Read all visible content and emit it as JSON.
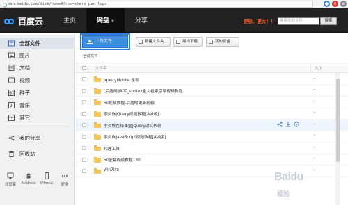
{
  "browser": {
    "url": "pan.baidu.com/disk/home#from=share_pan_logo"
  },
  "topnav": {
    "logo_text": "百度云",
    "items": [
      {
        "label": "主页"
      },
      {
        "label": "网盘"
      },
      {
        "label": "分享"
      }
    ],
    "promo_text": "更快、更大！！",
    "search_placeholder": "搜索你的文件",
    "search_button": "搜索"
  },
  "sidebar": {
    "items": [
      {
        "label": "全部文件",
        "icon": "all-files-icon"
      },
      {
        "label": "图片",
        "icon": "image-icon"
      },
      {
        "label": "文档",
        "icon": "document-icon"
      },
      {
        "label": "视频",
        "icon": "video-icon"
      },
      {
        "label": "种子",
        "icon": "torrent-icon"
      },
      {
        "label": "音乐",
        "icon": "music-icon"
      },
      {
        "label": "其它",
        "icon": "other-icon"
      },
      {
        "label": "我的分享",
        "icon": "share-icon"
      },
      {
        "label": "回收站",
        "icon": "trash-icon"
      }
    ],
    "devices": [
      {
        "label": "云管家",
        "icon": "desktop-icon"
      },
      {
        "label": "Android",
        "icon": "android-icon"
      },
      {
        "label": "iPhone",
        "icon": "iphone-icon"
      },
      {
        "label": "更多",
        "icon": "more-icon"
      }
    ]
  },
  "toolbar": {
    "upload_label": "上传文件",
    "new_folder_label": "新建文件夹",
    "offline_label": "离线下载",
    "devices_label": "我的设备"
  },
  "breadcrumb": "全部文件",
  "table": {
    "col_name": "文件名",
    "col_size": "大小",
    "rows": [
      {
        "name": "JqueryMobile 全部",
        "size": "-"
      },
      {
        "name": "[后盾网]网军_sphinx全文检索引擎视频教程",
        "size": "-"
      },
      {
        "name": "5ii视频教程-后盾的更新视频",
        "size": "-"
      },
      {
        "name": "李炎恢jQuery视频教程[AVI版]",
        "size": "-"
      },
      {
        "name": "李炎恢在线课堂jQuery讲义代码",
        "size": "-"
      },
      {
        "name": "李炎恢JavaScript视频教程[AVI版]",
        "size": "-"
      },
      {
        "name": "代理工具",
        "size": "-"
      },
      {
        "name": "5ii全套视频教程130",
        "size": "-"
      },
      {
        "name": "win7iso",
        "size": "-"
      }
    ]
  },
  "watermark": {
    "brand": "Baidu",
    "sub": "经验"
  },
  "colors": {
    "nav_bg": "#222222",
    "accent_blue": "#3b8ee0",
    "folder_yellow": "#f6c656",
    "promo_orange": "#ff5a1f"
  }
}
